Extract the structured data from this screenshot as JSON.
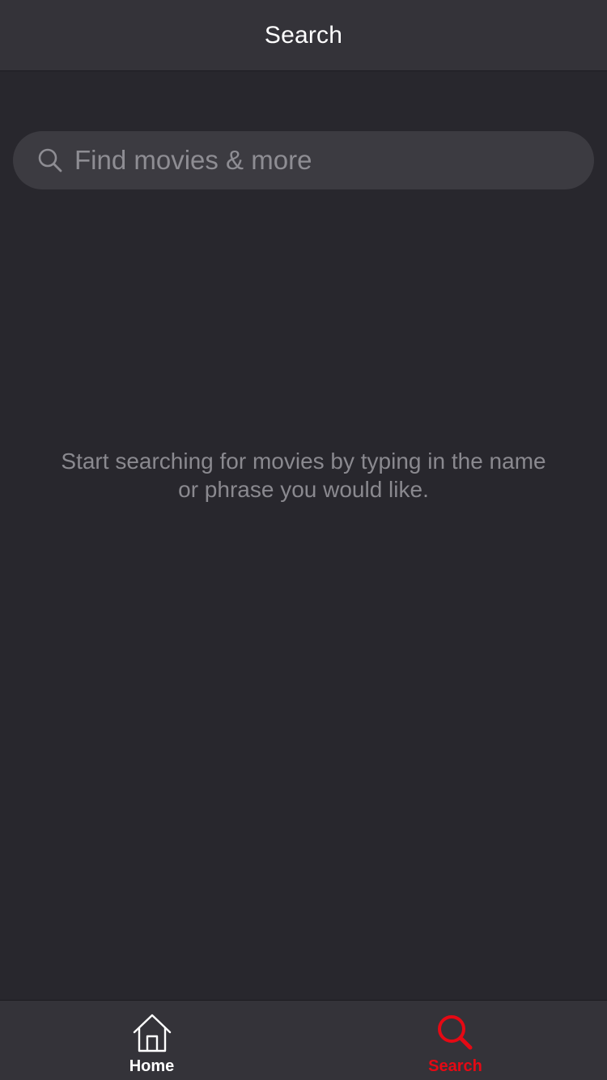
{
  "nav": {
    "title": "Search"
  },
  "search": {
    "placeholder": "Find movies & more",
    "value": "",
    "icon": "search-icon"
  },
  "empty_state": {
    "message": "Start searching for movies by typing in the name or phrase you would like."
  },
  "tabs": [
    {
      "label": "Home",
      "icon": "home-icon",
      "active": false
    },
    {
      "label": "Search",
      "icon": "search-icon",
      "active": true
    }
  ],
  "colors": {
    "background": "#28272d",
    "bar": "#343339",
    "search_field": "#3c3b41",
    "accent": "#e50914",
    "text_primary": "#ffffff",
    "text_secondary": "#8a898f"
  }
}
